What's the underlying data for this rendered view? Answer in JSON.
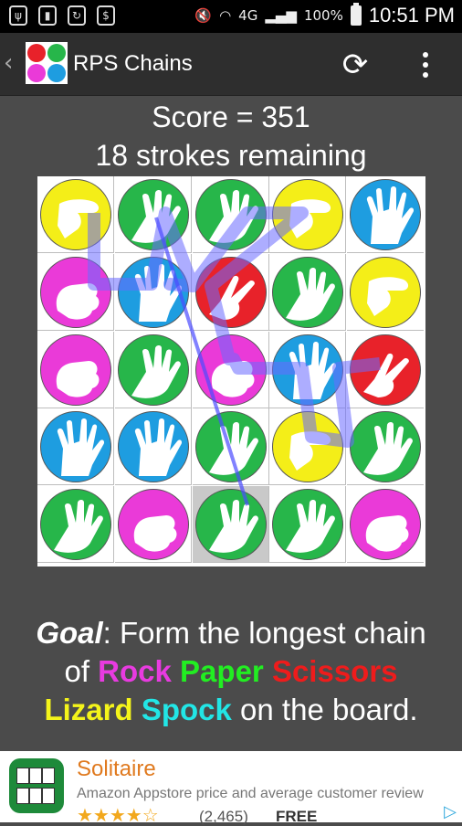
{
  "status_bar": {
    "icons": [
      "usb-icon",
      "battery-100-icon",
      "sync-icon",
      "dollar-icon",
      "mute-icon",
      "wifi-icon",
      "signal-icon",
      "battery-icon"
    ],
    "network": "4G",
    "battery_pct": "100%",
    "time": "10:51 PM"
  },
  "action_bar": {
    "title": "RPS Chains",
    "back_glyph": "‹",
    "refresh_glyph": "⟳"
  },
  "game": {
    "score_text": "Score = 351",
    "strokes_text": "18 strokes remaining",
    "colors": {
      "rock": "#ea3ad8",
      "paper": "#27b64a",
      "scissors": "#e8222a",
      "lizard": "#f4ee18",
      "spock": "#1e9de0"
    },
    "board": [
      [
        "lizard",
        "paper",
        "paper",
        "lizard",
        "spock"
      ],
      [
        "rock",
        "spock",
        "scissors",
        "paper",
        "lizard"
      ],
      [
        "rock",
        "paper",
        "rock",
        "spock",
        "scissors"
      ],
      [
        "spock",
        "spock",
        "paper",
        "lizard",
        "paper"
      ],
      [
        "paper",
        "rock",
        "paper",
        "paper",
        "rock"
      ]
    ],
    "selected_cell": [
      4,
      2
    ],
    "chain_color": "#6a6aff"
  },
  "goal": {
    "label": "Goal",
    "line1_rest": ": Form the longest chain",
    "of": "of ",
    "rock": "Rock",
    "paper": "Paper",
    "scissors": "Scissors",
    "lizard": "Lizard",
    "spock": "Spock",
    "line3_rest": " on the board.",
    "colors": {
      "rock": "#e83be0",
      "paper": "#22ee22",
      "scissors": "#ee1c1c",
      "lizard": "#f4f41a",
      "spock": "#22e6e6"
    }
  },
  "ad": {
    "title": "Solitaire",
    "subtitle": "Amazon Appstore price and average customer review",
    "stars": "★★★★☆",
    "rating_count": "(2,465)",
    "price": "FREE",
    "choices_glyph": "▷"
  }
}
